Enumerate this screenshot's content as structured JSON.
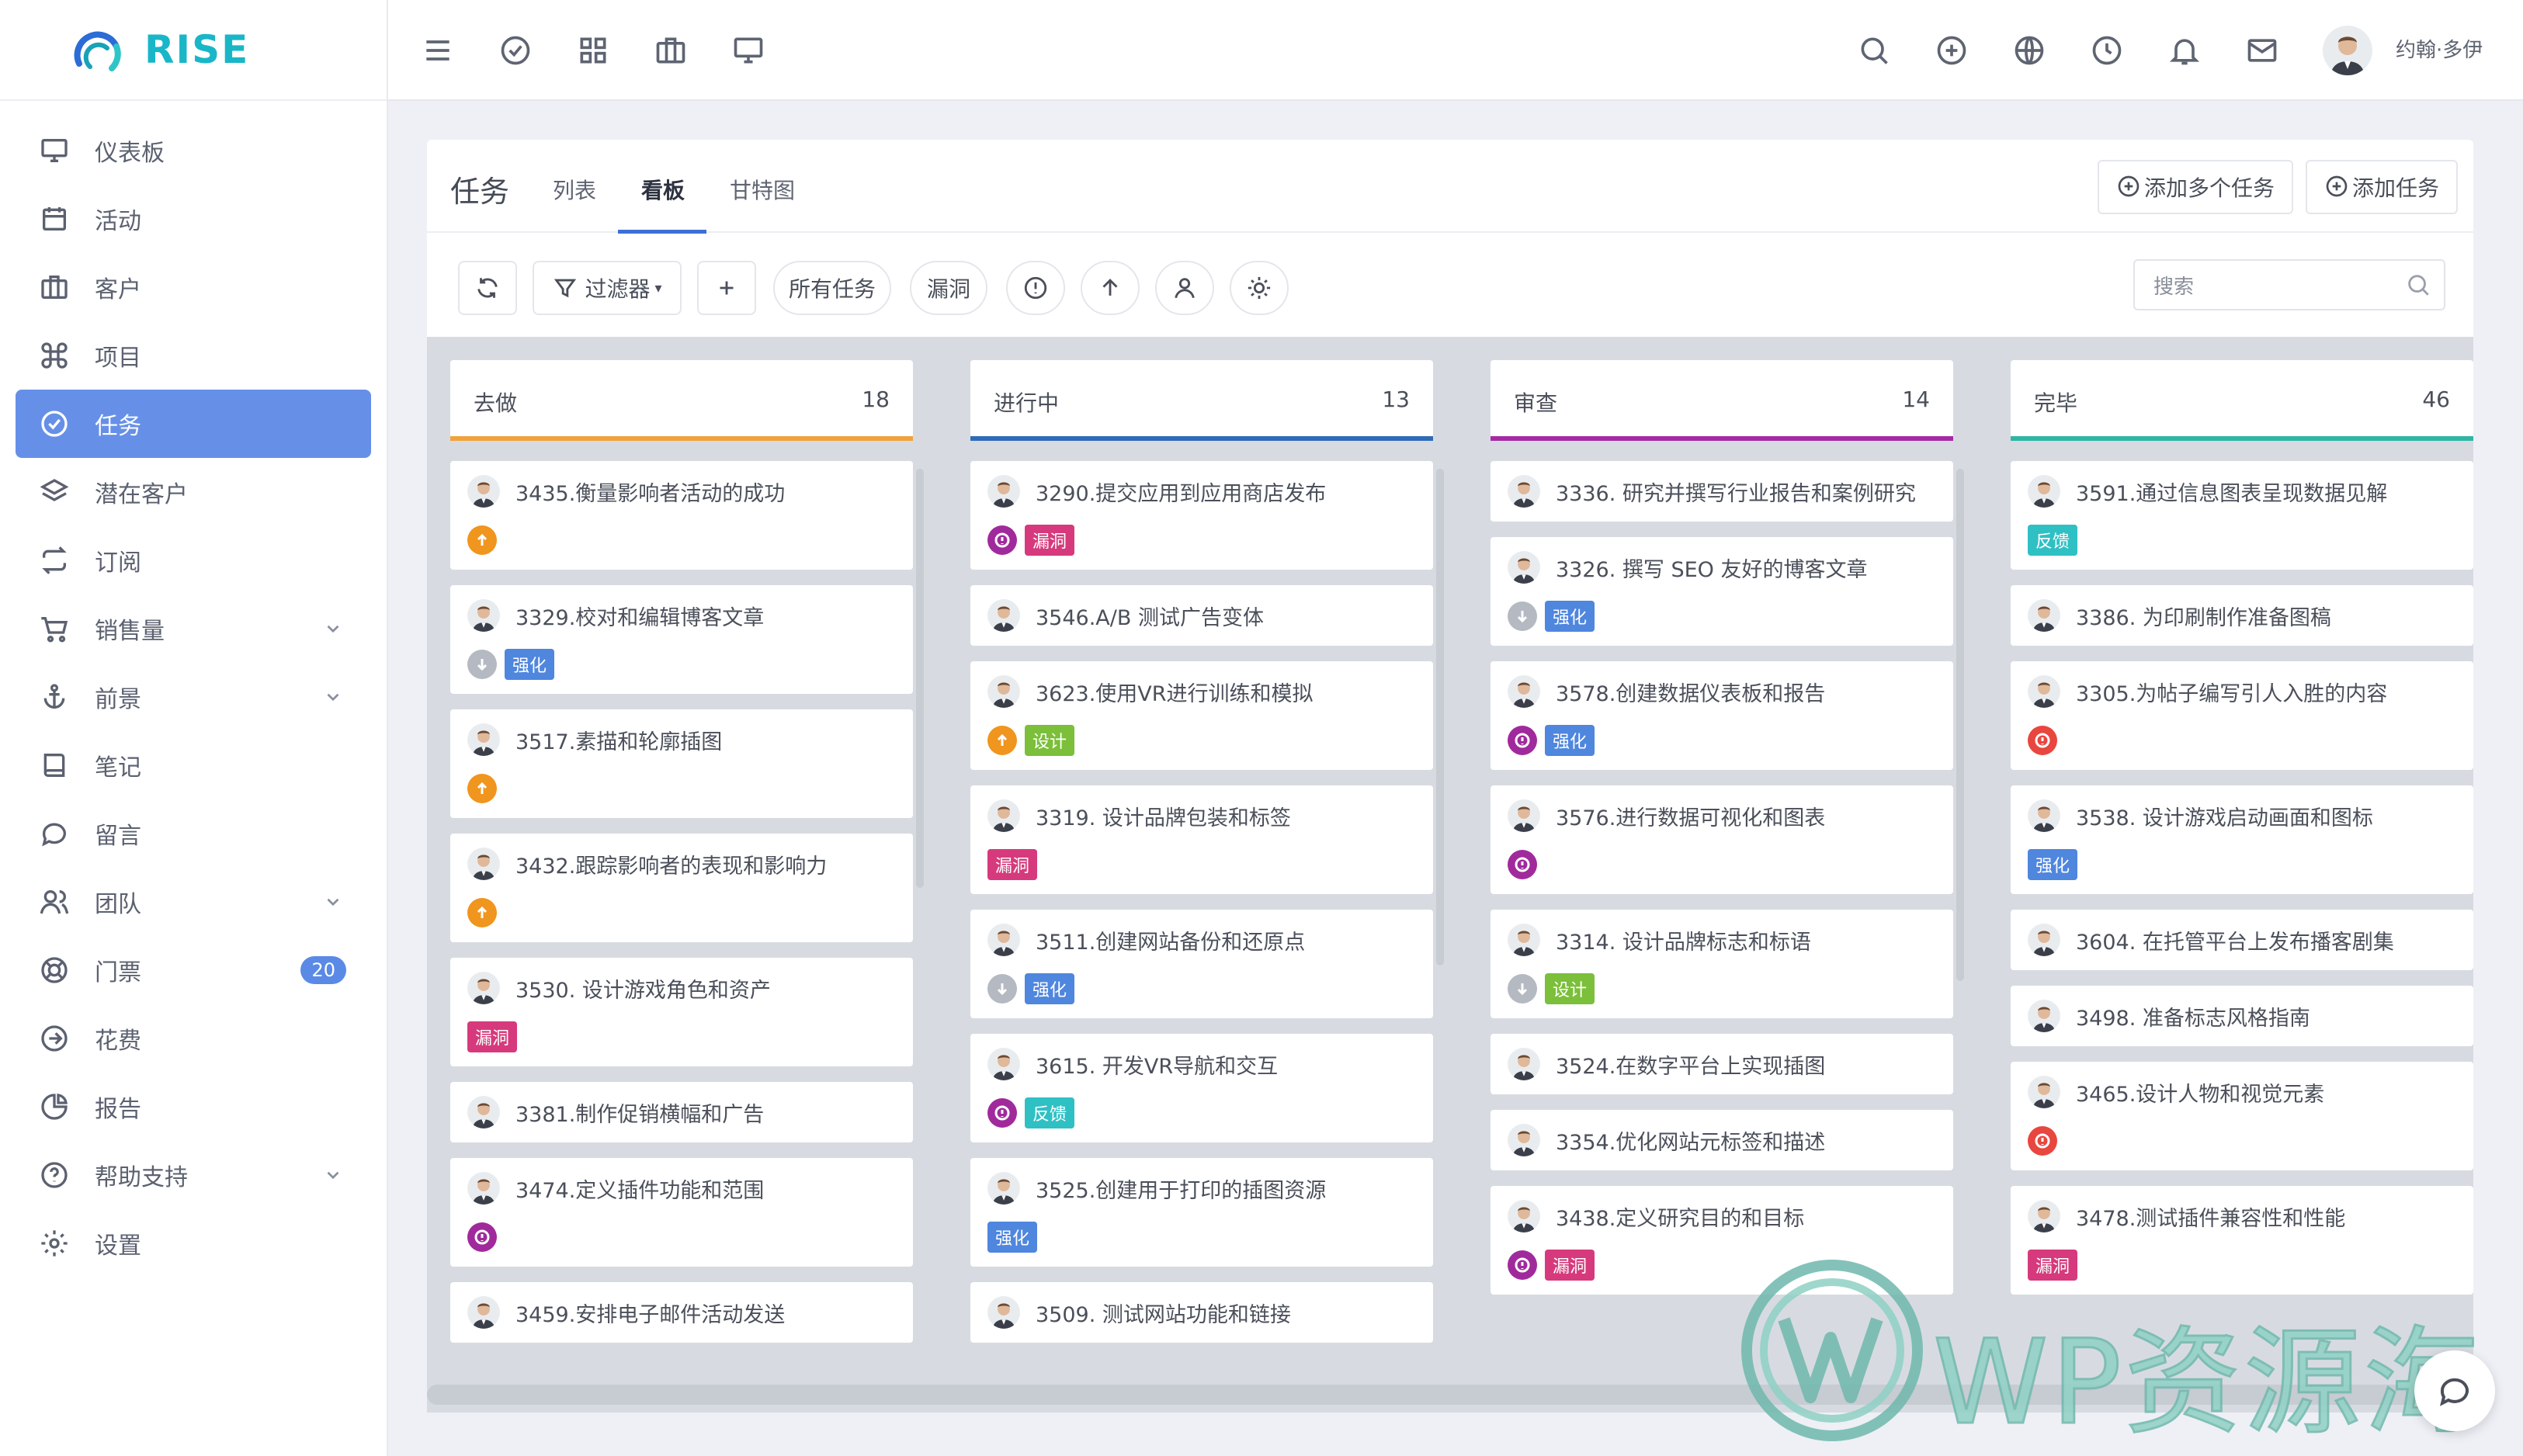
{
  "app": {
    "name": "RISE"
  },
  "sidebar": {
    "items": [
      {
        "label": "仪表板",
        "icon": "monitor-icon"
      },
      {
        "label": "活动",
        "icon": "calendar-icon"
      },
      {
        "label": "客户",
        "icon": "briefcase-icon"
      },
      {
        "label": "项目",
        "icon": "command-icon"
      },
      {
        "label": "任务",
        "icon": "check-circle-icon",
        "active": true
      },
      {
        "label": "潜在客户",
        "icon": "layers-icon"
      },
      {
        "label": "订阅",
        "icon": "repeat-icon"
      },
      {
        "label": "销售量",
        "icon": "cart-icon",
        "caret": true
      },
      {
        "label": "前景",
        "icon": "anchor-icon",
        "caret": true
      },
      {
        "label": "笔记",
        "icon": "book-icon"
      },
      {
        "label": "留言",
        "icon": "message-icon"
      },
      {
        "label": "团队",
        "icon": "users-icon",
        "caret": true
      },
      {
        "label": "门票",
        "icon": "lifebuoy-icon",
        "badge": "20"
      },
      {
        "label": "花费",
        "icon": "arrow-circle-icon"
      },
      {
        "label": "报告",
        "icon": "pie-chart-icon"
      },
      {
        "label": "帮助支持",
        "icon": "help-icon",
        "caret": true
      },
      {
        "label": "设置",
        "icon": "gear-icon"
      }
    ]
  },
  "topbar": {
    "user_name": "约翰·多伊"
  },
  "page": {
    "title": "任务",
    "tabs": [
      "列表",
      "看板",
      "甘特图"
    ],
    "add_multiple": "添加多个任务",
    "add_task": "添加任务",
    "filter_label": "过滤器",
    "chip_all": "所有任务",
    "chip_bug": "漏洞",
    "search_placeholder": "搜索"
  },
  "colors": {
    "todo": "#f0a23a",
    "in_progress": "#2f6bb8",
    "review": "#a52aa6",
    "done": "#2fb5a4",
    "label_bug": "#d63a7c",
    "label_enhance": "#4f86de",
    "label_design": "#7bbf3a",
    "label_feedback": "#2fc0c4",
    "pri_high": "#f0951e",
    "pri_low": "#b4b9c2",
    "pri_critical": "#a02a9c",
    "pri_blocker": "#e8463f"
  },
  "columns": [
    {
      "title": "去做",
      "count": "18",
      "color": "#f0a23a",
      "cards": [
        {
          "title": "3435.衡量影响者活动的成功",
          "priority": "high"
        },
        {
          "title": "3329.校对和编辑博客文章",
          "priority": "low",
          "label": "强化",
          "label_color": "#4f86de"
        },
        {
          "title": "3517.素描和轮廓插图",
          "priority": "high"
        },
        {
          "title": "3432.跟踪影响者的表现和影响力",
          "priority": "high"
        },
        {
          "title": "3530. 设计游戏角色和资产",
          "label": "漏洞",
          "label_color": "#d63a7c"
        },
        {
          "title": "3381.制作促销横幅和广告"
        },
        {
          "title": "3474.定义插件功能和范围",
          "priority": "critical"
        },
        {
          "title": "3459.安排电子邮件活动发送"
        }
      ]
    },
    {
      "title": "进行中",
      "count": "13",
      "color": "#2f6bb8",
      "cards": [
        {
          "title": "3290.提交应用到应用商店发布",
          "priority": "critical",
          "label": "漏洞",
          "label_color": "#d63a7c"
        },
        {
          "title": "3546.A/B 测试广告变体"
        },
        {
          "title": "3623.使用VR进行训练和模拟",
          "priority": "high",
          "label": "设计",
          "label_color": "#7bbf3a"
        },
        {
          "title": "3319. 设计品牌包装和标签",
          "label": "漏洞",
          "label_color": "#d63a7c"
        },
        {
          "title": "3511.创建网站备份和还原点",
          "priority": "low",
          "label": "强化",
          "label_color": "#4f86de"
        },
        {
          "title": "3615. 开发VR导航和交互",
          "priority": "critical",
          "label": "反馈",
          "label_color": "#2fc0c4"
        },
        {
          "title": "3525.创建用于打印的插图资源",
          "label": "强化",
          "label_color": "#4f86de"
        },
        {
          "title": "3509. 测试网站功能和链接"
        }
      ]
    },
    {
      "title": "审查",
      "count": "14",
      "color": "#a52aa6",
      "cards": [
        {
          "title": "3336. 研究并撰写行业报告和案例研究"
        },
        {
          "title": "3326. 撰写 SEO 友好的博客文章",
          "priority": "low",
          "label": "强化",
          "label_color": "#4f86de"
        },
        {
          "title": "3578.创建数据仪表板和报告",
          "priority": "critical",
          "label": "强化",
          "label_color": "#4f86de"
        },
        {
          "title": "3576.进行数据可视化和图表",
          "priority": "critical"
        },
        {
          "title": "3314. 设计品牌标志和标语",
          "priority": "low",
          "label": "设计",
          "label_color": "#7bbf3a"
        },
        {
          "title": "3524.在数字平台上实现插图"
        },
        {
          "title": "3354.优化网站元标签和描述"
        },
        {
          "title": "3438.定义研究目的和目标",
          "priority": "critical",
          "label": "漏洞",
          "label_color": "#d63a7c"
        }
      ]
    },
    {
      "title": "完毕",
      "count": "46",
      "color": "#2fb5a4",
      "cards": [
        {
          "title": "3591.通过信息图表呈现数据见解",
          "label": "反馈",
          "label_color": "#2fc0c4"
        },
        {
          "title": "3386. 为印刷制作准备图稿"
        },
        {
          "title": "3305.为帖子编写引人入胜的内容",
          "priority": "blocker"
        },
        {
          "title": "3538. 设计游戏启动画面和图标",
          "label": "强化",
          "label_color": "#4f86de"
        },
        {
          "title": "3604. 在托管平台上发布播客剧集"
        },
        {
          "title": "3498. 准备标志风格指南"
        },
        {
          "title": "3465.设计人物和视觉元素",
          "priority": "blocker"
        },
        {
          "title": "3478.测试插件兼容性和性能",
          "label": "漏洞",
          "label_color": "#d63a7c"
        }
      ]
    }
  ],
  "watermark": {
    "text": "WP资源海"
  }
}
